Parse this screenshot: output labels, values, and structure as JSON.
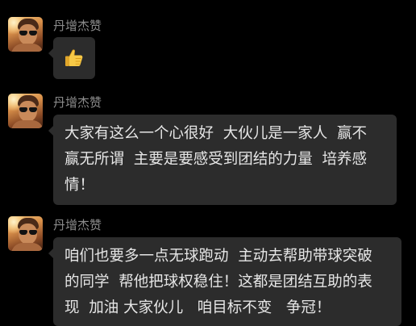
{
  "messages": [
    {
      "sender": "丹增杰赞",
      "emoji": "thumbs-up-icon"
    },
    {
      "sender": "丹增杰赞",
      "lines": [
        "大家有这么一个心很好  大伙儿是一家人  赢不",
        "赢无所谓  主要是要感受到团结的力量  培养感",
        "情！"
      ]
    },
    {
      "sender": "丹增杰赞",
      "lines": [
        "咱们也要多一点无球跑动  主动去帮助带球突破",
        "的同学  帮他把球权稳住！这都是团结互助的表",
        "现  加油 大家伙儿   咱目标不变   争冠！"
      ]
    }
  ],
  "colors": {
    "background": "#000000",
    "bubble": "#2c2c2c",
    "text": "#e6e6e6",
    "sender": "#8b8b8b"
  }
}
